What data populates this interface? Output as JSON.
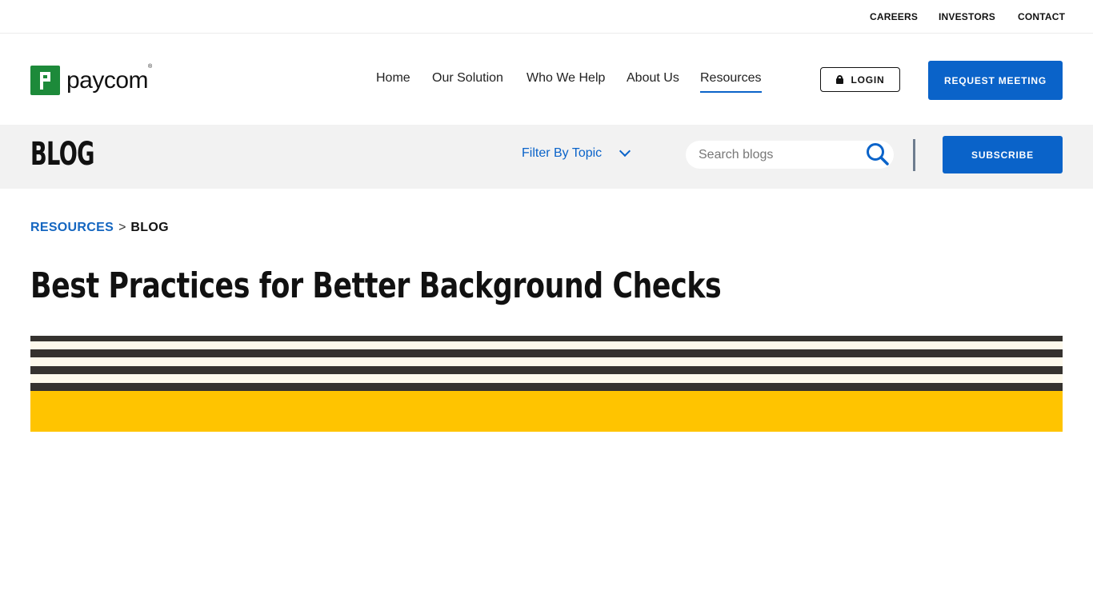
{
  "utility_nav": {
    "careers": "CAREERS",
    "investors": "INVESTORS",
    "contact": "CONTACT"
  },
  "brand": {
    "name": "paycom",
    "registered": "®",
    "logo_color": "#1d8a3a"
  },
  "main_nav": {
    "home": "Home",
    "our_solution": "Our Solution",
    "who_we_help": "Who We Help",
    "about_us": "About Us",
    "resources": "Resources",
    "active": "Resources"
  },
  "header_actions": {
    "login": "LOGIN",
    "request_meeting": "REQUEST MEETING"
  },
  "blog_bar": {
    "title": "BLOG",
    "filter_label": "Filter By Topic",
    "search_placeholder": "Search blogs",
    "subscribe": "SUBSCRIBE"
  },
  "breadcrumb": {
    "parent": "RESOURCES",
    "separator": ">",
    "current": "BLOG"
  },
  "article": {
    "title": "Best Practices for Better Background Checks"
  },
  "icons": {
    "lock": "lock-icon",
    "search": "search-icon",
    "chevron": "chevron-down-icon"
  },
  "colors": {
    "accent_blue": "#0a63c9",
    "band_gray": "#f2f2f2",
    "hero_gold": "#ffc400",
    "hero_stripe": "#35322f"
  }
}
